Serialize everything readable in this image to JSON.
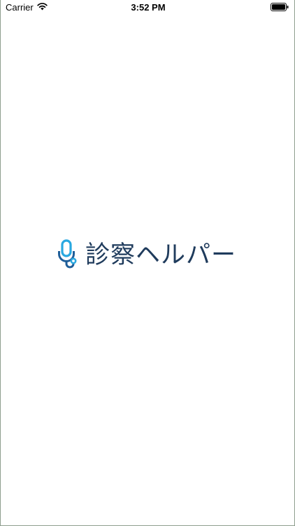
{
  "status_bar": {
    "carrier": "Carrier",
    "time": "3:52 PM",
    "icons": [
      "wifi-icon",
      "battery-icon"
    ]
  },
  "splash": {
    "app_name": "診察ヘルパー",
    "logo_icon": "stethoscope-icon"
  },
  "colors": {
    "brand_text": "#1f3b5c",
    "icon_light_blue": "#29a8e0",
    "icon_dark_blue": "#1f5e99",
    "background": "#ffffff"
  }
}
